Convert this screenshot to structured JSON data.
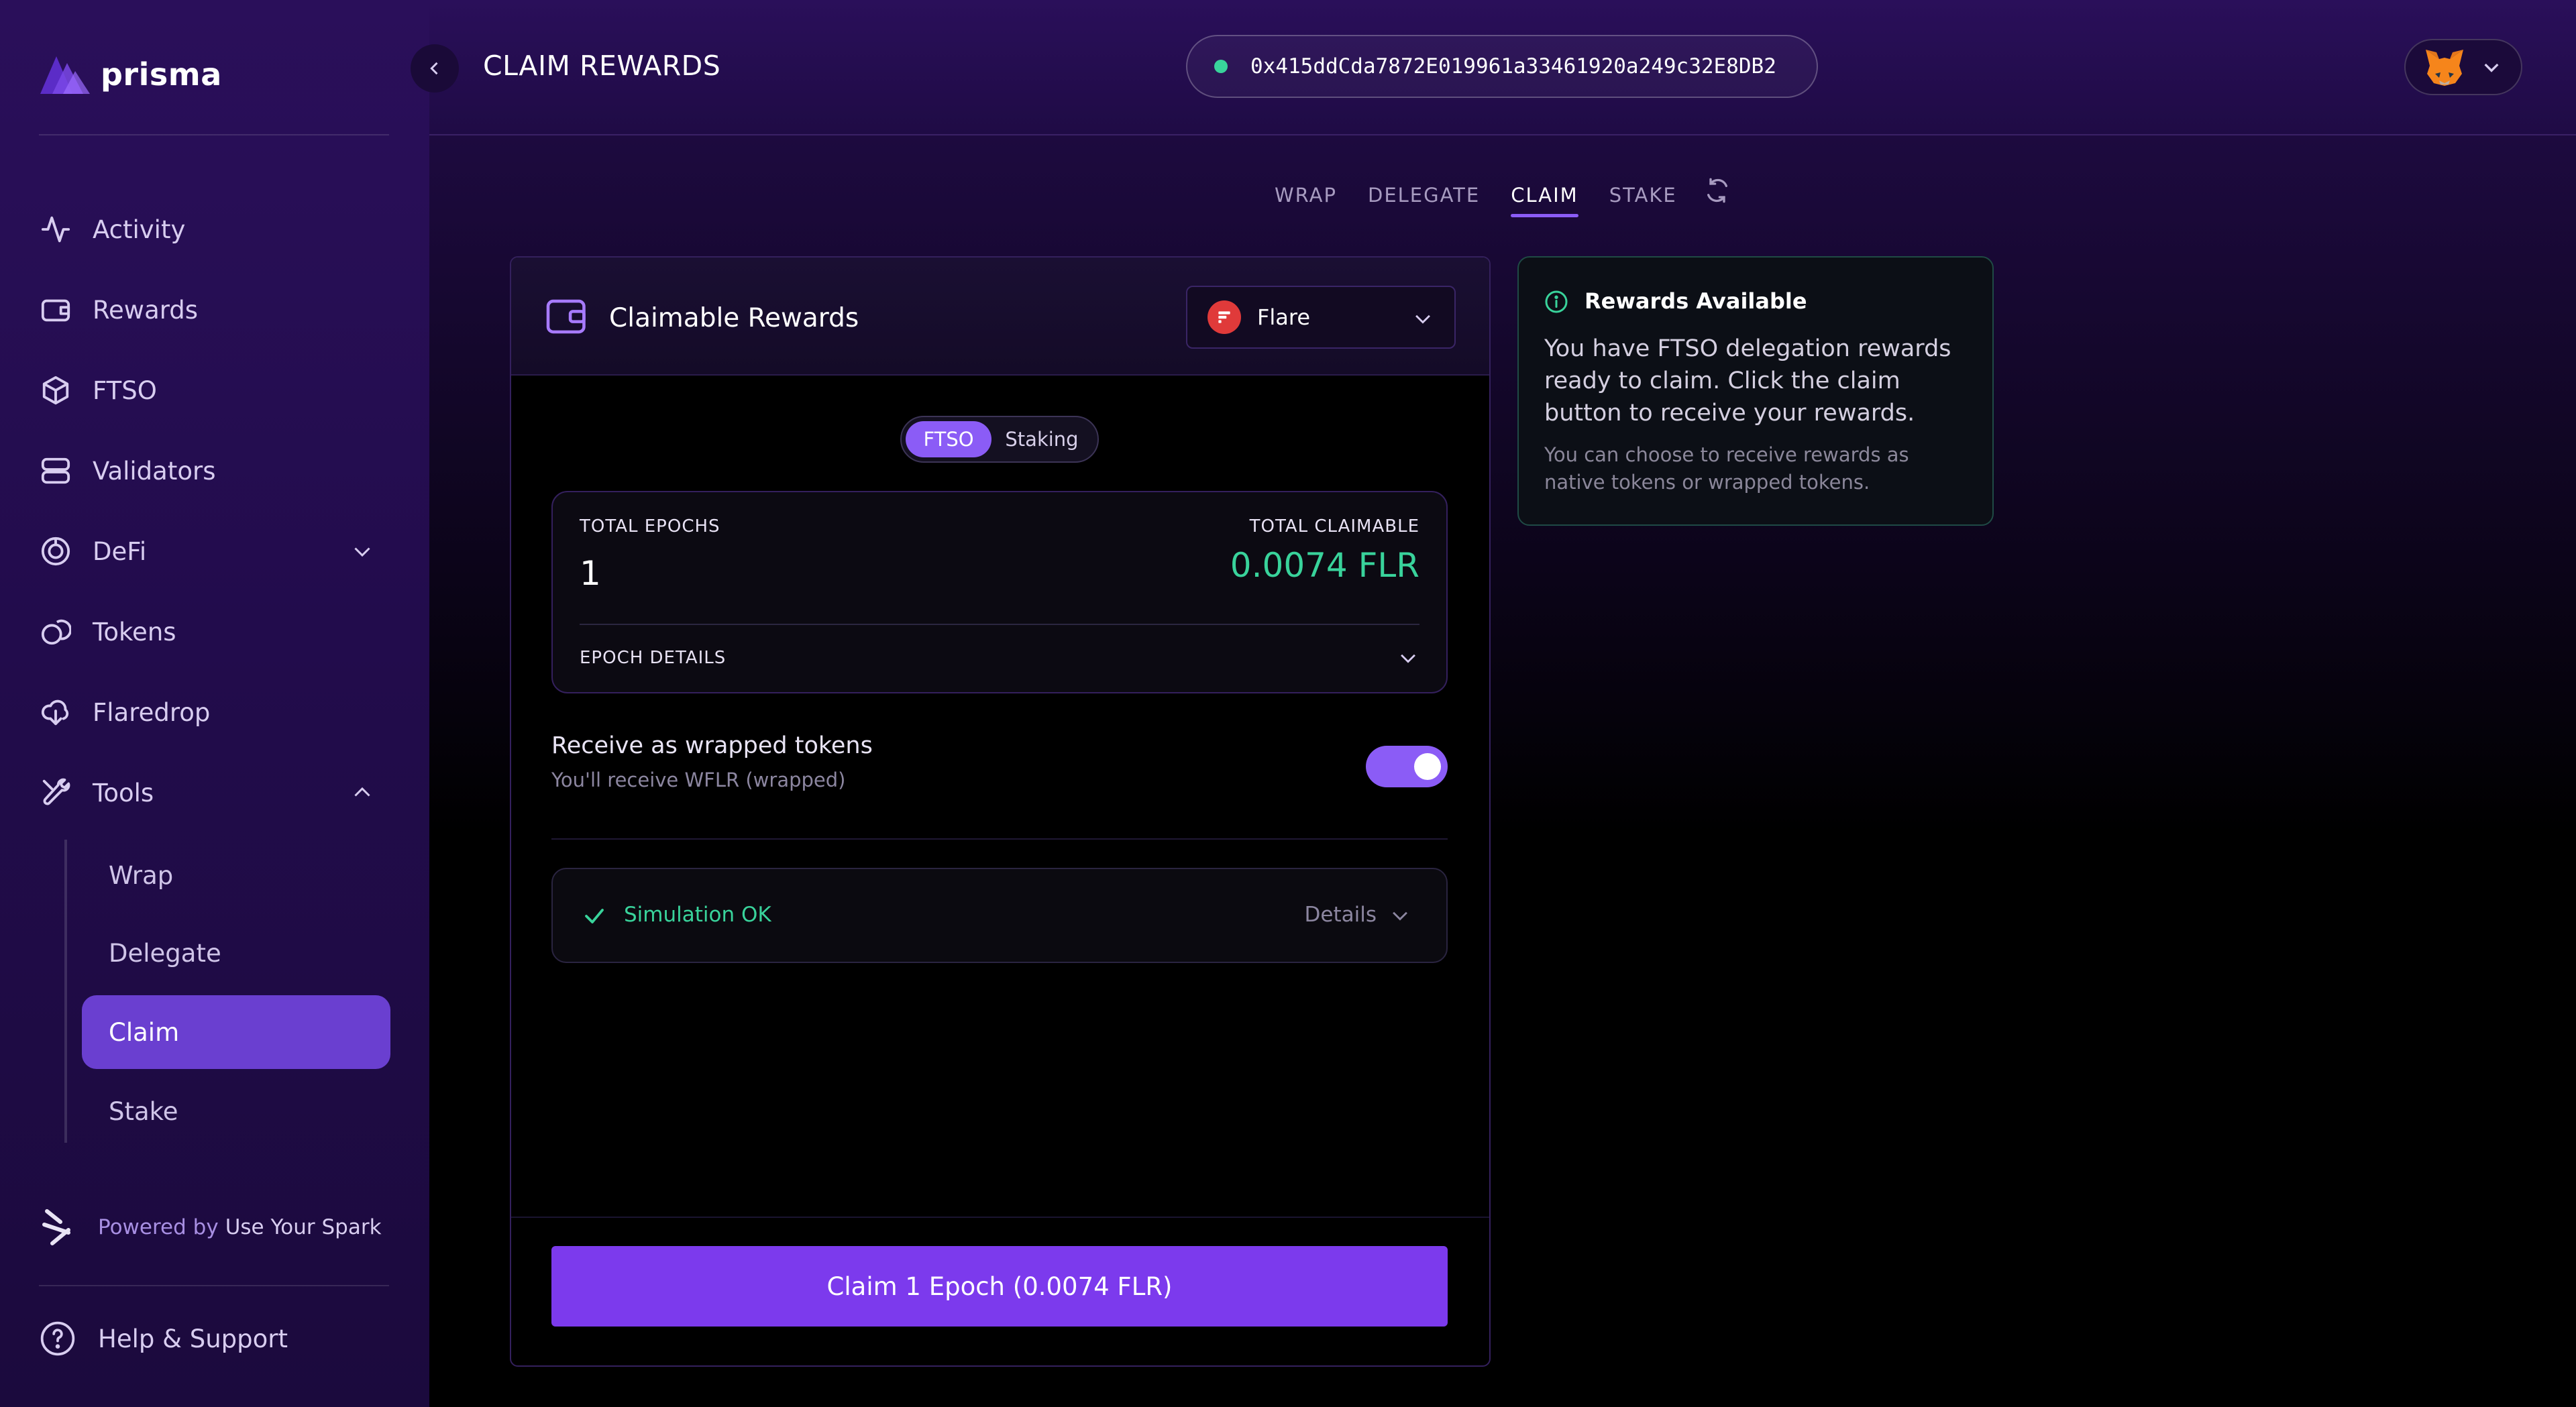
{
  "app": {
    "name": "prisma"
  },
  "sidebar": {
    "items": [
      {
        "label": "Activity",
        "icon": "activity-icon"
      },
      {
        "label": "Rewards",
        "icon": "wallet-icon"
      },
      {
        "label": "FTSO",
        "icon": "cube-icon"
      },
      {
        "label": "Validators",
        "icon": "server-icon"
      },
      {
        "label": "DeFi",
        "icon": "aperture-icon",
        "expandable": true,
        "expanded": false
      },
      {
        "label": "Tokens",
        "icon": "coins-icon"
      },
      {
        "label": "Flaredrop",
        "icon": "cloud-download-icon"
      },
      {
        "label": "Tools",
        "icon": "tools-icon",
        "expandable": true,
        "expanded": true
      }
    ],
    "tools_sub": [
      {
        "label": "Wrap",
        "active": false
      },
      {
        "label": "Delegate",
        "active": false
      },
      {
        "label": "Claim",
        "active": true
      },
      {
        "label": "Stake",
        "active": false
      }
    ],
    "powered_prefix": "Powered by",
    "powered_name": "Use Your Spark",
    "help_label": "Help & Support"
  },
  "header": {
    "title": "CLAIM REWARDS",
    "wallet_address": "0x415ddCda7872E019961a33461920a249c32E8DB2",
    "wallet_status_color": "#39d39b"
  },
  "tabs": [
    {
      "label": "WRAP",
      "active": false
    },
    {
      "label": "DELEGATE",
      "active": false
    },
    {
      "label": "CLAIM",
      "active": true
    },
    {
      "label": "STAKE",
      "active": false
    }
  ],
  "claim_card": {
    "title": "Claimable Rewards",
    "network": "Flare",
    "segments": [
      {
        "label": "FTSO",
        "active": true
      },
      {
        "label": "Staking",
        "active": false
      }
    ],
    "total_epochs_label": "TOTAL EPOCHS",
    "total_epochs_value": "1",
    "total_claimable_label": "TOTAL CLAIMABLE",
    "total_claimable_value": "0.0074 FLR",
    "epoch_details_label": "EPOCH DETAILS",
    "wrap_title": "Receive as wrapped tokens",
    "wrap_subtitle": "You'll receive WFLR (wrapped)",
    "wrap_enabled": true,
    "simulation_status": "Simulation OK",
    "simulation_details_label": "Details",
    "claim_button_label": "Claim 1 Epoch (0.0074 FLR)"
  },
  "info_card": {
    "title": "Rewards Available",
    "body": "You have FTSO delegation rewards ready to claim. Click the claim button to receive your rewards.",
    "note": "You can choose to receive rewards as native tokens or wrapped tokens."
  },
  "colors": {
    "accent": "#8b5cf6",
    "success": "#39d39b",
    "sidebar_bg": "#240d50",
    "active_nav": "#6a3fd0",
    "flare_red": "#e03a3a"
  }
}
